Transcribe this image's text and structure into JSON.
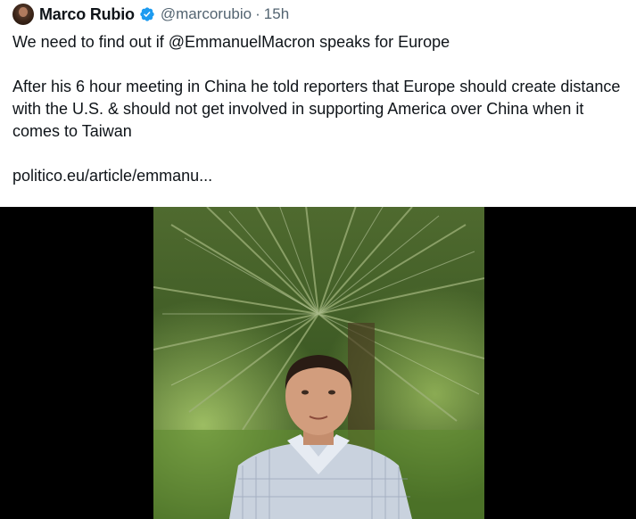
{
  "tweet": {
    "author_name": "Marco Rubio",
    "handle": "@marcorubio",
    "separator": "·",
    "timestamp": "15h",
    "line1": "We need to find out if @EmmanuelMacron speaks for Europe",
    "line2": "After his 6 hour meeting in China he told reporters that Europe should create distance with the U.S. & should not get involved in supporting America over China when it comes to Taiwan",
    "link": "politico.eu/article/emmanu..."
  },
  "colors": {
    "verified": "#1d9bf0",
    "secondary_text": "#536471",
    "media_bg": "#000000"
  },
  "icons": {
    "verified": "verified-badge-icon"
  }
}
